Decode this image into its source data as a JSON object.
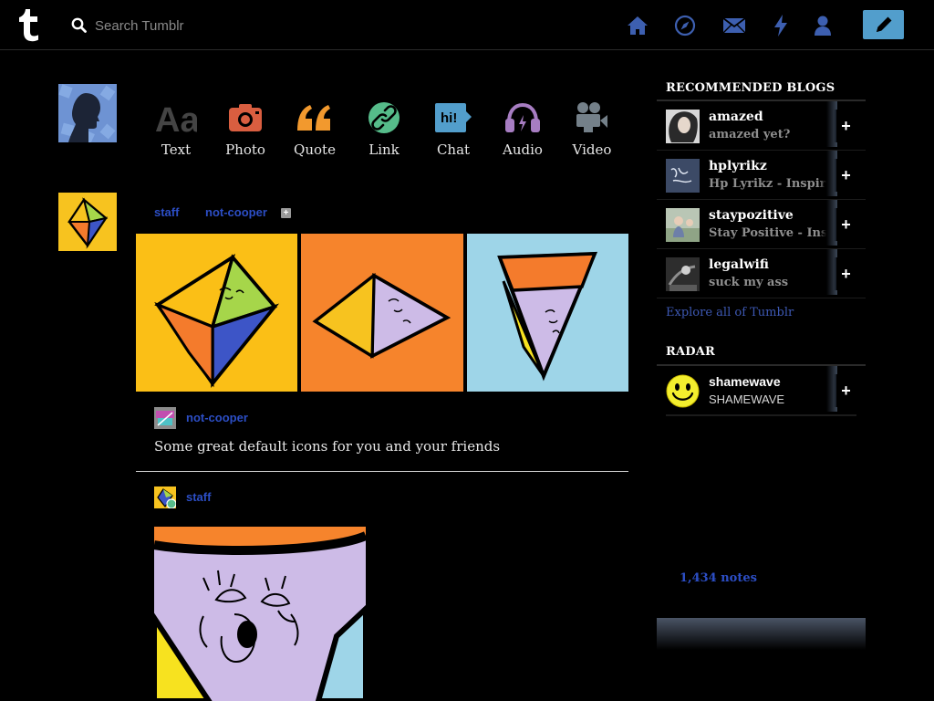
{
  "search": {
    "placeholder": "Search Tumblr"
  },
  "nav": {
    "logo_letter": "t",
    "icons": [
      "home-icon",
      "explore-icon",
      "inbox-icon",
      "activity-icon",
      "account-icon"
    ],
    "compose_icon": "pencil-icon",
    "accent": "#529ecc",
    "icon_color": "#3d5fb0"
  },
  "post_types": [
    {
      "label": "Text",
      "icon": "text-icon",
      "color": "#444444"
    },
    {
      "label": "Photo",
      "icon": "photo-icon",
      "color": "#d95e40"
    },
    {
      "label": "Quote",
      "icon": "quote-icon",
      "color": "#f2992e"
    },
    {
      "label": "Link",
      "icon": "link-icon",
      "color": "#56bc8a"
    },
    {
      "label": "Chat",
      "icon": "chat-icon",
      "color": "#529ecc"
    },
    {
      "label": "Audio",
      "icon": "audio-icon",
      "color": "#a77dc2"
    },
    {
      "label": "Video",
      "icon": "video-icon",
      "color": "#748089"
    }
  ],
  "post1": {
    "reblogger": "staff",
    "source": "not-cooper",
    "source_name": "not-cooper",
    "caption": "Some great default icons for you and your friends"
  },
  "post2": {
    "author": "staff"
  },
  "sidebar": {
    "recommended_title": "RECOMMENDED BLOGS",
    "blogs": [
      {
        "name": "amazed",
        "desc": "amazed yet?"
      },
      {
        "name": "hplyrikz",
        "desc": "Hp Lyrikz - Inspiring"
      },
      {
        "name": "staypozitive",
        "desc": "Stay Positive - Inspiring"
      },
      {
        "name": "legalwifi",
        "desc": "suck my ass"
      }
    ],
    "follow_label": "+",
    "explore_label": "Explore all of Tumblr",
    "radar_title": "RADAR",
    "radar": {
      "name": "shamewave",
      "desc": "SHAMEWAVE",
      "notes": "1,434 notes"
    }
  }
}
